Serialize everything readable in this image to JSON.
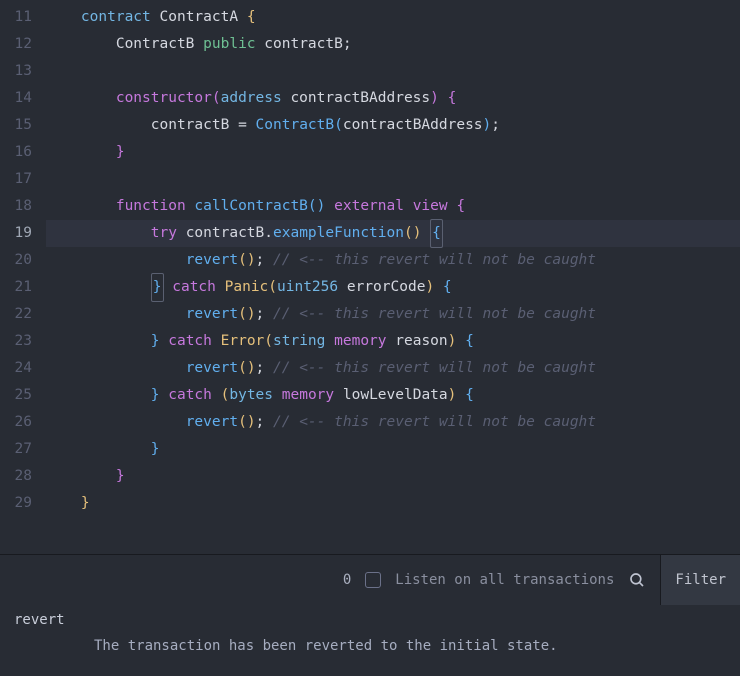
{
  "gutter": {
    "start": 11,
    "end": 29,
    "current": 19
  },
  "code": {
    "l11": {
      "kw": "contract",
      "name": "ContractA",
      "ob": "{"
    },
    "l12": {
      "name": "ContractB",
      "mod": "public",
      "var": "contractB",
      "sc": ";"
    },
    "l14": {
      "kw": "constructor",
      "po": "(",
      "type": "address",
      "arg": "contractBAddress",
      "pc": ")",
      "ob": "{"
    },
    "l15": {
      "lhs": "contractB",
      "eq": " = ",
      "cls": "ContractB",
      "po": "(",
      "arg": "contractBAddress",
      "pc": ")",
      "sc": ";"
    },
    "l16": {
      "cb": "}"
    },
    "l18": {
      "kw": "function",
      "name": "callContractB",
      "po": "(",
      "pc": ")",
      "mod": "external view",
      "ob": "{"
    },
    "l19": {
      "kw": "try",
      "obj": "contractB",
      "dot": ".",
      "fn": "exampleFunction",
      "po": "(",
      "pc": ")",
      "ob": "{"
    },
    "l20": {
      "fn": "revert",
      "po": "(",
      "pc": ")",
      "sc": ";",
      "comment": "// <-- this revert will not be caught"
    },
    "l21": {
      "cb": "}",
      "kw": "catch",
      "err": "Panic",
      "po": "(",
      "type": "uint256",
      "arg": "errorCode",
      "pc": ")",
      "ob": "{"
    },
    "l22": {
      "fn": "revert",
      "po": "(",
      "pc": ")",
      "sc": ";",
      "comment": "// <-- this revert will not be caught"
    },
    "l23": {
      "cb": "}",
      "kw": "catch",
      "err": "Error",
      "po": "(",
      "type": "string",
      "mem": "memory",
      "arg": "reason",
      "pc": ")",
      "ob": "{"
    },
    "l24": {
      "fn": "revert",
      "po": "(",
      "pc": ")",
      "sc": ";",
      "comment": "// <-- this revert will not be caught"
    },
    "l25": {
      "cb": "}",
      "kw": "catch",
      "po": "(",
      "type": "bytes",
      "mem": "memory",
      "arg": "lowLevelData",
      "pc": ")",
      "ob": "{"
    },
    "l26": {
      "fn": "revert",
      "po": "(",
      "pc": ")",
      "sc": ";",
      "comment": "// <-- this revert will not be caught"
    },
    "l27": {
      "cb": "}"
    },
    "l28": {
      "cb": "}"
    },
    "l29": {
      "cb": "}"
    }
  },
  "panel": {
    "count": "0",
    "listen": "Listen on all transactions",
    "filter": "Filter"
  },
  "console": {
    "title": "revert",
    "msg": "The transaction has been reverted to the initial state."
  }
}
